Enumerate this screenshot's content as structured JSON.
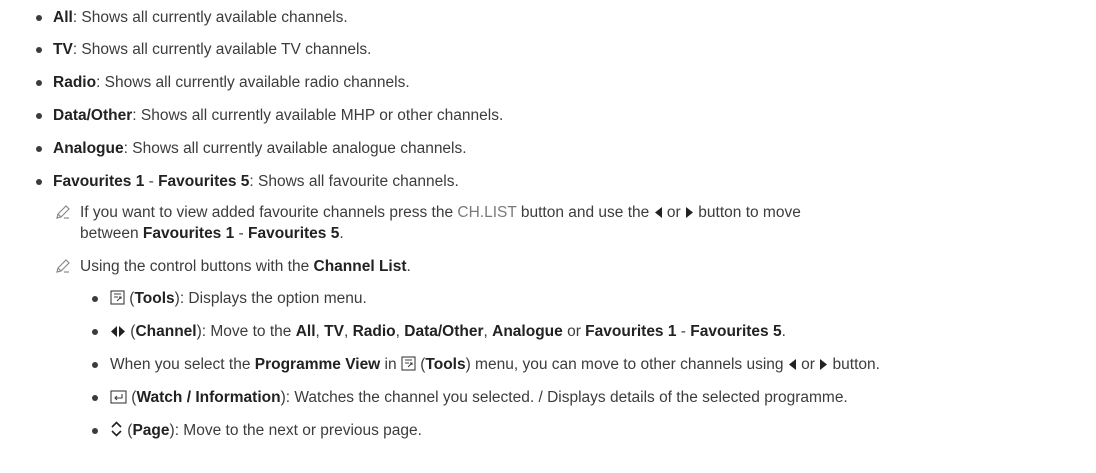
{
  "items": [
    {
      "term": "All",
      "desc": ": Shows all currently available channels."
    },
    {
      "term": "TV",
      "desc": ": Shows all currently available TV channels."
    },
    {
      "term": "Radio",
      "desc": ": Shows all currently available radio channels."
    },
    {
      "term": "Data/Other",
      "desc": ": Shows all currently available MHP or other channels."
    },
    {
      "term": "Analogue",
      "desc": ": Shows all currently available analogue channels."
    },
    {
      "term": "Favourites 1",
      "sep": " - ",
      "term2": "Favourites 5",
      "desc": ": Shows all favourite channels."
    }
  ],
  "note1": {
    "p1": "If you want to view added favourite channels press the ",
    "key": "CH.LIST",
    "p2": " button and use the ",
    "p3": " or ",
    "p4": " button to move",
    "line2_t1": "Favourites 1",
    "line2_sep": " - ",
    "line2_t2": "Favourites 5",
    "line2_pre": "between ",
    "line2_end": "."
  },
  "note2": {
    "p1": "Using the control buttons with the ",
    "term": "Channel List",
    "end": "."
  },
  "sub": {
    "tools": {
      "open": " (",
      "term": "Tools",
      "desc": "): Displays the option menu."
    },
    "channel": {
      "open": " (",
      "term": "Channel",
      "p1": "): Move to the ",
      "t1": "All",
      "c1": ", ",
      "t2": "TV",
      "c2": ", ",
      "t3": "Radio",
      "c3": ", ",
      "t4": "Data/Other",
      "c4": ", ",
      "t5": "Analogue",
      "or": " or ",
      "t6": "Favourites 1",
      "sep": " - ",
      "t7": "Favourites 5",
      "end": "."
    },
    "programme": {
      "p1": "When you select the ",
      "term": "Programme View",
      "p2": " in ",
      "open": " (",
      "tools": "Tools",
      "p3": ") menu, you can move to other channels using ",
      "or": " or ",
      "end": " button."
    },
    "watch": {
      "open": " (",
      "term": "Watch / Information",
      "desc": "): Watches the channel you selected. / Displays details of the selected programme."
    },
    "page": {
      "open": " (",
      "term": "Page",
      "desc": "): Move to the next or previous page."
    }
  },
  "icons": {
    "note": "pencil-note-icon",
    "tools": "tools-icon",
    "left": "left-arrow-icon",
    "right": "right-arrow-icon",
    "enter": "enter-icon",
    "updown": "up-down-chevron-icon"
  }
}
